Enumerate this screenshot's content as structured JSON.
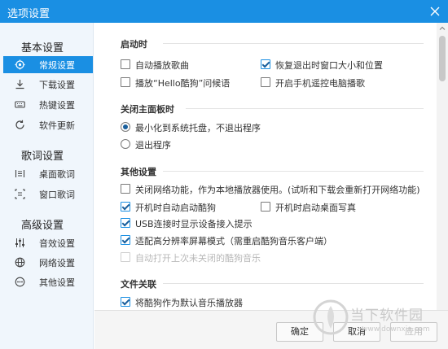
{
  "window": {
    "title": "选项设置"
  },
  "sidebar": {
    "groups": [
      {
        "title": "基本设置",
        "items": [
          {
            "label": "常规设置",
            "icon": "gear-icon",
            "active": true
          },
          {
            "label": "下载设置",
            "icon": "download-icon"
          },
          {
            "label": "热键设置",
            "icon": "keyboard-icon"
          },
          {
            "label": "软件更新",
            "icon": "refresh-icon"
          }
        ]
      },
      {
        "title": "歌词设置",
        "items": [
          {
            "label": "桌面歌词",
            "icon": "desktop-lyrics-icon"
          },
          {
            "label": "窗口歌词",
            "icon": "window-lyrics-icon"
          }
        ]
      },
      {
        "title": "高级设置",
        "items": [
          {
            "label": "音效设置",
            "icon": "equalizer-icon"
          },
          {
            "label": "网络设置",
            "icon": "globe-icon"
          },
          {
            "label": "其他设置",
            "icon": "more-icon"
          }
        ]
      }
    ]
  },
  "sections": {
    "startup": {
      "title": "启动时",
      "options": [
        {
          "label": "自动播放歌曲",
          "checked": false
        },
        {
          "label": "恢复退出时窗口大小和位置",
          "checked": true
        },
        {
          "label": "播放“Hello酷狗”问候语",
          "checked": false
        },
        {
          "label": "开启手机遥控电脑播歌",
          "checked": false
        }
      ]
    },
    "close": {
      "title": "关闭主面板时",
      "options": [
        {
          "label": "最小化到系统托盘，不退出程序",
          "checked": true
        },
        {
          "label": "退出程序",
          "checked": false
        }
      ]
    },
    "other": {
      "title": "其他设置",
      "options": [
        {
          "label": "关闭网络功能，作为本地播放器使用。(试听和下载会重新打开网络功能)",
          "checked": false
        },
        {
          "label": "开机时自动启动酷狗",
          "checked": true
        },
        {
          "label": "开机时启动桌面写真",
          "checked": false
        },
        {
          "label": "USB连接时显示设备接入提示",
          "checked": true
        },
        {
          "label": "适配高分辨率屏幕模式（需重启酷狗音乐客户端）",
          "checked": true
        },
        {
          "label": "自动打开上次未关闭的酷狗音乐",
          "checked": false,
          "disabled": true
        }
      ]
    },
    "file_assoc": {
      "title": "文件关联",
      "options": [
        {
          "label": "将酷狗作为默认音乐播放器",
          "checked": true
        }
      ]
    }
  },
  "footer": {
    "ok": "确定",
    "cancel": "取消",
    "apply": "应用"
  },
  "watermark": {
    "text": "当下软件园",
    "url": "www.downxia.com"
  },
  "colors": {
    "accent": "#1a8fe3"
  }
}
